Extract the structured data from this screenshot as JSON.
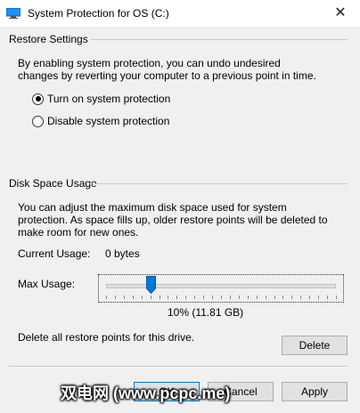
{
  "window": {
    "title": "System Protection for OS (C:)",
    "close_glyph": "✕",
    "icon": "computer-icon"
  },
  "restore_settings": {
    "heading": "Restore Settings",
    "description": "By enabling system protection, you can undo undesired changes by reverting your computer to a previous point in time.",
    "options": [
      {
        "label": "Turn on system protection",
        "checked": true
      },
      {
        "label": "Disable system protection",
        "checked": false
      }
    ]
  },
  "disk_space": {
    "heading": "Disk Space Usage",
    "description": "You can adjust the maximum disk space used for system protection. As space fills up, older restore points will be deleted to make room for new ones.",
    "current_usage_label": "Current Usage:",
    "current_usage_value": "0 bytes",
    "max_usage_label": "Max Usage:",
    "max_usage_fraction": 0.1,
    "max_usage_value": "10% (11.81 GB)",
    "delete_text": "Delete all restore points for this drive.",
    "delete_label": "Delete"
  },
  "footer": {
    "ok_label": "OK",
    "cancel_label": "Cancel",
    "apply_label": "Apply"
  },
  "watermark": {
    "text": "双电网 (www.pcpc.me)"
  }
}
